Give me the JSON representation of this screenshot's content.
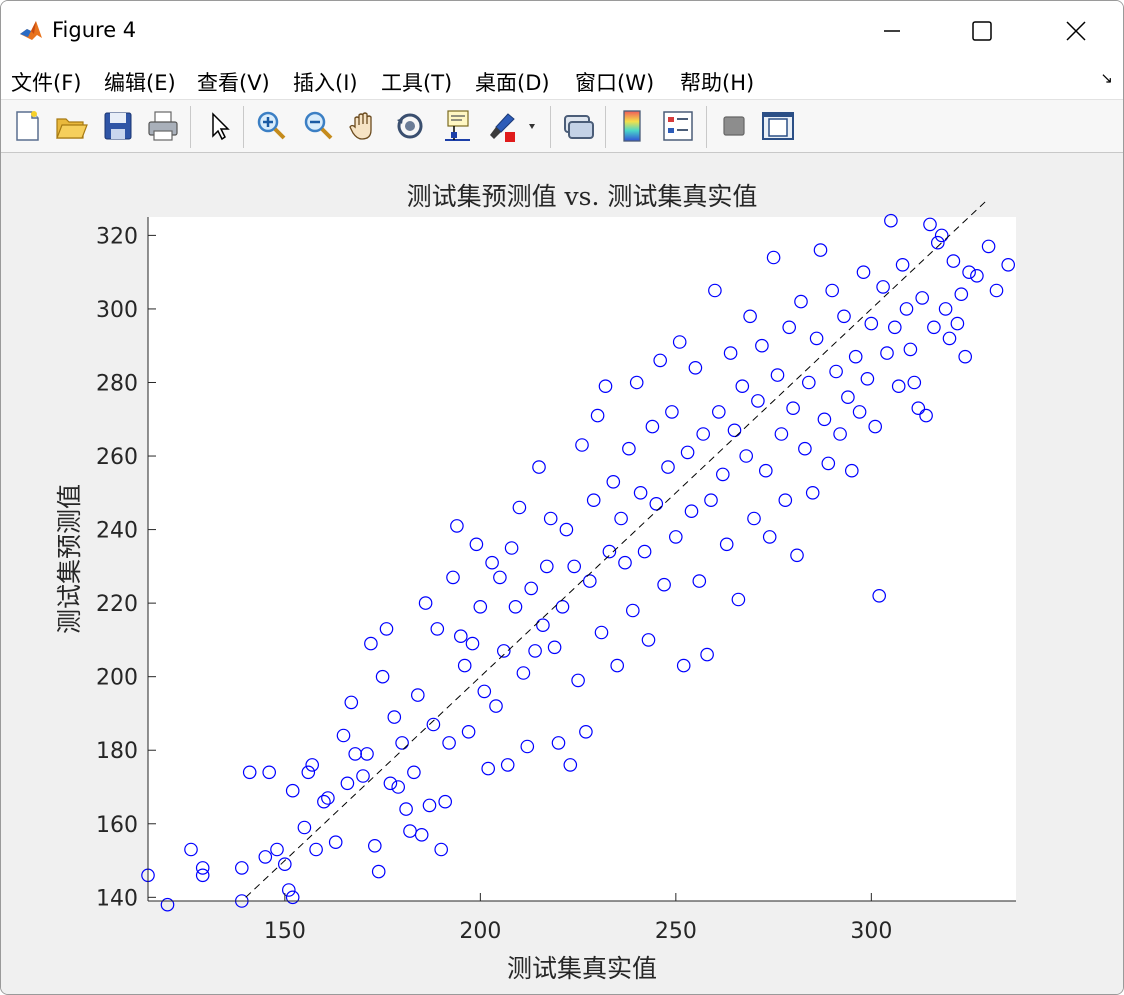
{
  "window": {
    "title": "Figure 4"
  },
  "menubar": {
    "items": [
      "文件(F)",
      "编辑(E)",
      "查看(V)",
      "插入(I)",
      "工具(T)",
      "桌面(D)",
      "窗口(W)",
      "帮助(H)"
    ]
  },
  "toolbar": {
    "buttons": [
      {
        "name": "new-figure-button",
        "icon": "new-document-icon"
      },
      {
        "name": "open-file-button",
        "icon": "folder-open-icon"
      },
      {
        "name": "save-button",
        "icon": "floppy-disk-icon"
      },
      {
        "name": "print-button",
        "icon": "printer-icon"
      },
      {
        "name": "edit-plot-button",
        "icon": "arrow-pointer-icon"
      },
      {
        "name": "zoom-in-button",
        "icon": "zoom-in-icon"
      },
      {
        "name": "zoom-out-button",
        "icon": "zoom-out-icon"
      },
      {
        "name": "pan-button",
        "icon": "hand-icon"
      },
      {
        "name": "rotate-3d-button",
        "icon": "rotate-icon"
      },
      {
        "name": "data-cursor-button",
        "icon": "data-tip-icon"
      },
      {
        "name": "brush-button",
        "icon": "brush-icon"
      },
      {
        "name": "link-plot-button",
        "icon": "link-icon"
      },
      {
        "name": "colorbar-button",
        "icon": "colorbar-icon"
      },
      {
        "name": "legend-button",
        "icon": "legend-icon"
      },
      {
        "name": "hide-plot-tools-button",
        "icon": "hide-tools-icon"
      },
      {
        "name": "show-plot-tools-button",
        "icon": "show-tools-icon"
      }
    ]
  },
  "colors": {
    "marker": "#0000ff",
    "reference_line": "#000000",
    "axes_background": "#ffffff",
    "figure_background": "#f0f0f0"
  },
  "chart_data": {
    "type": "scatter",
    "title": "测试集预测值 vs. 测试集真实值",
    "xlabel": "测试集真实值",
    "ylabel": "测试集预测值",
    "xlim": [
      115,
      337
    ],
    "ylim": [
      139,
      325
    ],
    "xticks": [
      150,
      200,
      250,
      300
    ],
    "yticks": [
      140,
      160,
      180,
      200,
      220,
      240,
      260,
      280,
      300,
      320
    ],
    "marker": "circle-open",
    "reference_line": {
      "style": "dashed",
      "from": [
        140,
        140
      ],
      "to": [
        330,
        330
      ]
    },
    "grid": false,
    "legend": "none",
    "series": [
      {
        "points": [
          [
            115,
            146
          ],
          [
            120,
            138
          ],
          [
            126,
            153
          ],
          [
            129,
            148
          ],
          [
            129,
            146
          ],
          [
            139,
            148
          ],
          [
            139,
            139
          ],
          [
            141,
            174
          ],
          [
            145,
            151
          ],
          [
            146,
            174
          ],
          [
            148,
            153
          ],
          [
            150,
            149
          ],
          [
            151,
            142
          ],
          [
            152,
            140
          ],
          [
            152,
            169
          ],
          [
            155,
            159
          ],
          [
            156,
            174
          ],
          [
            157,
            176
          ],
          [
            158,
            153
          ],
          [
            160,
            166
          ],
          [
            161,
            167
          ],
          [
            163,
            155
          ],
          [
            165,
            184
          ],
          [
            166,
            171
          ],
          [
            167,
            193
          ],
          [
            168,
            179
          ],
          [
            170,
            173
          ],
          [
            171,
            179
          ],
          [
            172,
            209
          ],
          [
            173,
            154
          ],
          [
            174,
            147
          ],
          [
            175,
            200
          ],
          [
            176,
            213
          ],
          [
            177,
            171
          ],
          [
            178,
            189
          ],
          [
            179,
            170
          ],
          [
            180,
            182
          ],
          [
            181,
            164
          ],
          [
            182,
            158
          ],
          [
            183,
            174
          ],
          [
            184,
            195
          ],
          [
            185,
            157
          ],
          [
            186,
            220
          ],
          [
            187,
            165
          ],
          [
            188,
            187
          ],
          [
            189,
            213
          ],
          [
            190,
            153
          ],
          [
            191,
            166
          ],
          [
            192,
            182
          ],
          [
            193,
            227
          ],
          [
            194,
            241
          ],
          [
            195,
            211
          ],
          [
            196,
            203
          ],
          [
            197,
            185
          ],
          [
            198,
            209
          ],
          [
            199,
            236
          ],
          [
            200,
            219
          ],
          [
            201,
            196
          ],
          [
            202,
            175
          ],
          [
            203,
            231
          ],
          [
            204,
            192
          ],
          [
            205,
            227
          ],
          [
            206,
            207
          ],
          [
            207,
            176
          ],
          [
            208,
            235
          ],
          [
            209,
            219
          ],
          [
            210,
            246
          ],
          [
            211,
            201
          ],
          [
            212,
            181
          ],
          [
            213,
            224
          ],
          [
            214,
            207
          ],
          [
            215,
            257
          ],
          [
            216,
            214
          ],
          [
            217,
            230
          ],
          [
            218,
            243
          ],
          [
            219,
            208
          ],
          [
            220,
            182
          ],
          [
            221,
            219
          ],
          [
            222,
            240
          ],
          [
            223,
            176
          ],
          [
            224,
            230
          ],
          [
            225,
            199
          ],
          [
            226,
            263
          ],
          [
            227,
            185
          ],
          [
            228,
            226
          ],
          [
            229,
            248
          ],
          [
            230,
            271
          ],
          [
            231,
            212
          ],
          [
            232,
            279
          ],
          [
            233,
            234
          ],
          [
            234,
            253
          ],
          [
            235,
            203
          ],
          [
            236,
            243
          ],
          [
            237,
            231
          ],
          [
            238,
            262
          ],
          [
            239,
            218
          ],
          [
            240,
            280
          ],
          [
            241,
            250
          ],
          [
            242,
            234
          ],
          [
            243,
            210
          ],
          [
            244,
            268
          ],
          [
            245,
            247
          ],
          [
            246,
            286
          ],
          [
            247,
            225
          ],
          [
            248,
            257
          ],
          [
            249,
            272
          ],
          [
            250,
            238
          ],
          [
            251,
            291
          ],
          [
            252,
            203
          ],
          [
            253,
            261
          ],
          [
            254,
            245
          ],
          [
            255,
            284
          ],
          [
            256,
            226
          ],
          [
            257,
            266
          ],
          [
            258,
            206
          ],
          [
            259,
            248
          ],
          [
            260,
            305
          ],
          [
            261,
            272
          ],
          [
            262,
            255
          ],
          [
            263,
            236
          ],
          [
            264,
            288
          ],
          [
            265,
            267
          ],
          [
            266,
            221
          ],
          [
            267,
            279
          ],
          [
            268,
            260
          ],
          [
            269,
            298
          ],
          [
            270,
            243
          ],
          [
            271,
            275
          ],
          [
            272,
            290
          ],
          [
            273,
            256
          ],
          [
            274,
            238
          ],
          [
            275,
            314
          ],
          [
            276,
            282
          ],
          [
            277,
            266
          ],
          [
            278,
            248
          ],
          [
            279,
            295
          ],
          [
            280,
            273
          ],
          [
            281,
            233
          ],
          [
            282,
            302
          ],
          [
            283,
            262
          ],
          [
            284,
            280
          ],
          [
            285,
            250
          ],
          [
            286,
            292
          ],
          [
            287,
            316
          ],
          [
            288,
            270
          ],
          [
            289,
            258
          ],
          [
            290,
            305
          ],
          [
            291,
            283
          ],
          [
            292,
            266
          ],
          [
            293,
            298
          ],
          [
            294,
            276
          ],
          [
            295,
            256
          ],
          [
            296,
            287
          ],
          [
            297,
            272
          ],
          [
            298,
            310
          ],
          [
            299,
            281
          ],
          [
            300,
            296
          ],
          [
            301,
            268
          ],
          [
            302,
            222
          ],
          [
            303,
            306
          ],
          [
            304,
            288
          ],
          [
            305,
            324
          ],
          [
            306,
            295
          ],
          [
            307,
            279
          ],
          [
            308,
            312
          ],
          [
            309,
            300
          ],
          [
            310,
            289
          ],
          [
            311,
            280
          ],
          [
            312,
            273
          ],
          [
            313,
            303
          ],
          [
            314,
            271
          ],
          [
            315,
            323
          ],
          [
            316,
            295
          ],
          [
            317,
            318
          ],
          [
            318,
            320
          ],
          [
            319,
            300
          ],
          [
            320,
            292
          ],
          [
            321,
            313
          ],
          [
            322,
            296
          ],
          [
            323,
            304
          ],
          [
            324,
            287
          ],
          [
            325,
            310
          ],
          [
            327,
            309
          ],
          [
            330,
            317
          ],
          [
            332,
            305
          ],
          [
            335,
            312
          ]
        ]
      }
    ]
  }
}
